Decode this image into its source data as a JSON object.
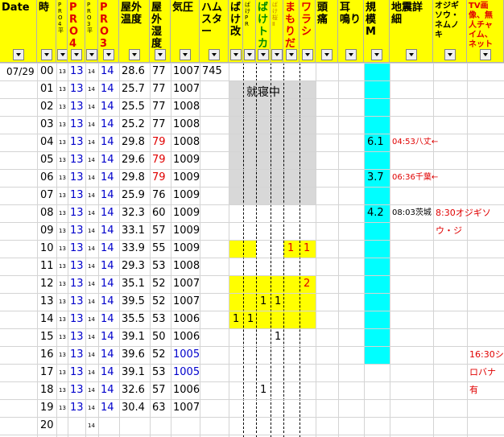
{
  "headers": [
    {
      "key": "date",
      "label": "Date"
    },
    {
      "key": "hour",
      "label": "時"
    },
    {
      "key": "pr04_small",
      "label": "PRO4平"
    },
    {
      "key": "pr04",
      "label": "PR O4"
    },
    {
      "key": "pr03_small",
      "label": "PRO3平"
    },
    {
      "key": "pr03",
      "label": "PR O3"
    },
    {
      "key": "temp",
      "label": "屋外 温度"
    },
    {
      "key": "humidity",
      "label": "屋外 湿度"
    },
    {
      "key": "pressure",
      "label": "気圧"
    },
    {
      "key": "hamster",
      "label": "ハム スター"
    },
    {
      "key": "bake_kai",
      "label": "ばけ 改"
    },
    {
      "key": "bake_pr",
      "label": "ばけ PR"
    },
    {
      "key": "bake_toka",
      "label": "ばけ トカ"
    },
    {
      "key": "bake_sakura",
      "label": "ばけ 桜 Ⅱ"
    },
    {
      "key": "mamorida",
      "label": "まもり だ"
    },
    {
      "key": "warashi",
      "label": "ワラシ"
    },
    {
      "key": "headache",
      "label": "頭 痛"
    },
    {
      "key": "tinnitus",
      "label": "耳 鳴り"
    },
    {
      "key": "magnitude",
      "label": "規 模 M"
    },
    {
      "key": "quake_detail",
      "label": "地震詳細"
    },
    {
      "key": "ojigi",
      "label": "オジギ ソウ・ ネムノ キ"
    },
    {
      "key": "tv",
      "label": "TV画 像、無 人チャ イム、 ネット"
    }
  ],
  "sleep_label": "就寝中",
  "rows": [
    {
      "date": "07/29",
      "hour": "00",
      "p4s": "13",
      "p4": "13",
      "p3s": "14",
      "p3": "14",
      "temp": "28.6",
      "hum": "77",
      "pres": "1007",
      "ham": "745"
    },
    {
      "hour": "01",
      "p4s": "13",
      "p4": "13",
      "p3s": "14",
      "p3": "14",
      "temp": "25.7",
      "hum": "77",
      "pres": "1007"
    },
    {
      "hour": "02",
      "p4s": "13",
      "p4": "13",
      "p3s": "14",
      "p3": "14",
      "temp": "25.5",
      "hum": "77",
      "pres": "1008"
    },
    {
      "hour": "03",
      "p4s": "13",
      "p4": "13",
      "p3s": "14",
      "p3": "14",
      "temp": "25.2",
      "hum": "77",
      "pres": "1008"
    },
    {
      "hour": "04",
      "p4s": "13",
      "p4": "13",
      "p3s": "14",
      "p3": "14",
      "temp": "29.8",
      "hum": "79",
      "hum_red": true,
      "pres": "1008",
      "mag": "6.1",
      "quake": "04:53八丈←"
    },
    {
      "hour": "05",
      "p4s": "13",
      "p4": "13",
      "p3s": "14",
      "p3": "14",
      "temp": "29.6",
      "hum": "79",
      "hum_red": true,
      "pres": "1009"
    },
    {
      "hour": "06",
      "p4s": "13",
      "p4": "13",
      "p3s": "14",
      "p3": "14",
      "temp": "29.8",
      "hum": "79",
      "hum_red": true,
      "pres": "1009",
      "mag": "3.7",
      "quake": "06:36千葉←"
    },
    {
      "hour": "07",
      "p4s": "13",
      "p4": "13",
      "p3s": "14",
      "p3": "14",
      "temp": "25.9",
      "hum": "76",
      "pres": "1009"
    },
    {
      "hour": "08",
      "p4s": "13",
      "p4": "13",
      "p3s": "14",
      "p3": "14",
      "temp": "32.3",
      "hum": "60",
      "pres": "1009",
      "mag": "4.2",
      "quake": "08:03茨城",
      "ojigi": "8:30オジギソウ・ジ"
    },
    {
      "hour": "09",
      "p4s": "13",
      "p4": "13",
      "p3s": "14",
      "p3": "14",
      "temp": "33.1",
      "hum": "57",
      "pres": "1009"
    },
    {
      "hour": "10",
      "p4s": "13",
      "p4": "13",
      "p3s": "14",
      "p3": "14",
      "temp": "33.9",
      "hum": "55",
      "pres": "1009",
      "mamo": "1",
      "wara": "1"
    },
    {
      "hour": "11",
      "p4s": "13",
      "p4": "13",
      "p3s": "14",
      "p3": "14",
      "temp": "29.3",
      "hum": "53",
      "pres": "1008"
    },
    {
      "hour": "12",
      "p4s": "13",
      "p4": "13",
      "p3s": "14",
      "p3": "14",
      "temp": "35.1",
      "hum": "52",
      "pres": "1007",
      "wara": "2"
    },
    {
      "hour": "13",
      "p4s": "13",
      "p4": "13",
      "p3s": "14",
      "p3": "14",
      "temp": "39.5",
      "hum": "52",
      "pres": "1007",
      "toka": "1",
      "sakura": "1"
    },
    {
      "hour": "14",
      "p4s": "13",
      "p4": "13",
      "p3s": "14",
      "p3": "14",
      "temp": "35.5",
      "hum": "53",
      "pres": "1006",
      "kai": "1",
      "pr": "1"
    },
    {
      "hour": "15",
      "p4s": "13",
      "p4": "13",
      "p3s": "14",
      "p3": "14",
      "temp": "39.1",
      "hum": "50",
      "pres": "1006",
      "sakura": "1"
    },
    {
      "hour": "16",
      "p4s": "13",
      "p4": "13",
      "p3s": "14",
      "p3": "14",
      "temp": "39.6",
      "hum": "52",
      "pres": "1005",
      "pres_blue": true,
      "tv": "16:30シロバナ有"
    },
    {
      "hour": "17",
      "p4s": "13",
      "p4": "13",
      "p3s": "14",
      "p3": "14",
      "temp": "39.1",
      "hum": "53",
      "pres": "1005",
      "pres_blue": true
    },
    {
      "hour": "18",
      "p4s": "13",
      "p4": "13",
      "p3s": "14",
      "p3": "14",
      "temp": "32.6",
      "hum": "57",
      "pres": "1006",
      "toka": "1"
    },
    {
      "hour": "19",
      "p4s": "13",
      "p4": "13",
      "p3s": "14",
      "p3": "14",
      "temp": "30.4",
      "hum": "63",
      "pres": "1007"
    },
    {
      "hour": "20",
      "p3s": "14"
    }
  ],
  "colors": {
    "header": "#ffff00",
    "highlight": "#ffff00",
    "sleep": "#d8d8d8",
    "cyan": "#00ffff",
    "blue": "#0000cc",
    "red": "#e00000"
  }
}
